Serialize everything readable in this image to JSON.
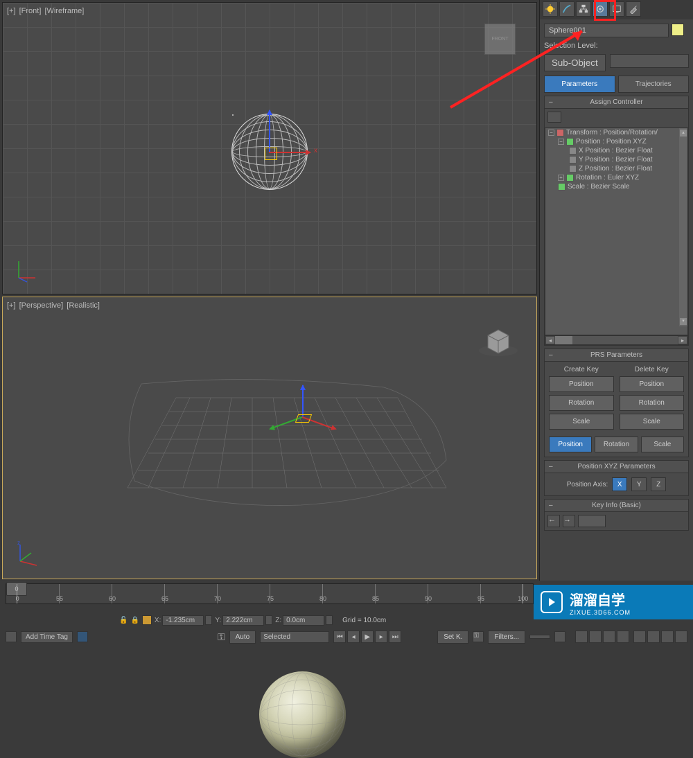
{
  "viewports": {
    "front": {
      "labels": [
        "[+]",
        "[Front]",
        "[Wireframe]"
      ],
      "cube_label": "FRONT",
      "x_label": "x"
    },
    "perspective": {
      "labels": [
        "[+]",
        "[Perspective]",
        "[Realistic]"
      ],
      "z_label": "z"
    }
  },
  "command_panel": {
    "tabs": [
      "create",
      "modify",
      "hierarchy",
      "motion",
      "display",
      "utilities"
    ],
    "active_tab": "motion",
    "object_name": "Sphere001",
    "selection_level_label": "Selection Level:",
    "sub_object_label": "Sub-Object",
    "param_tabs": {
      "parameters": "Parameters",
      "trajectories": "Trajectories"
    },
    "rollouts": {
      "assign_controller": {
        "title": "Assign Controller",
        "tree": [
          {
            "level": 1,
            "exp": "-",
            "label": "Transform : Position/Rotation/"
          },
          {
            "level": 2,
            "exp": "-",
            "label": "Position : Position XYZ"
          },
          {
            "level": 3,
            "exp": "",
            "label": "X Position : Bezier Float"
          },
          {
            "level": 3,
            "exp": "",
            "label": "Y Position : Bezier Float"
          },
          {
            "level": 3,
            "exp": "",
            "label": "Z Position : Bezier Float"
          },
          {
            "level": 2,
            "exp": "+",
            "label": "Rotation : Euler XYZ"
          },
          {
            "level": 2,
            "exp": "",
            "label": "Scale : Bezier Scale"
          }
        ]
      },
      "prs_parameters": {
        "title": "PRS Parameters",
        "create_key": "Create Key",
        "delete_key": "Delete Key",
        "buttons": [
          "Position",
          "Rotation",
          "Scale"
        ],
        "row": [
          "Position",
          "Rotation",
          "Scale"
        ]
      },
      "position_xyz": {
        "title": "Position XYZ Parameters",
        "axis_label": "Position Axis:",
        "axes": [
          "X",
          "Y",
          "Z"
        ]
      },
      "key_info": {
        "title": "Key Info (Basic)"
      }
    }
  },
  "timeline": {
    "ticks": [
      0,
      55,
      60,
      65,
      70,
      75,
      80,
      85,
      90,
      95,
      100
    ],
    "slider": "0"
  },
  "status": {
    "x_label": "X:",
    "x_val": "-1.235cm",
    "y_label": "Y:",
    "y_val": "2.222cm",
    "z_label": "Z:",
    "z_val": "0.0cm",
    "grid": "Grid = 10.0cm"
  },
  "bottom": {
    "auto": "Auto",
    "setk": "Set K.",
    "selected": "Selected",
    "filters": "Filters...",
    "add_time_tag": "Add Time Tag"
  },
  "watermark": {
    "text": "溜溜自学",
    "url": "ZIXUE.3D66.COM"
  }
}
